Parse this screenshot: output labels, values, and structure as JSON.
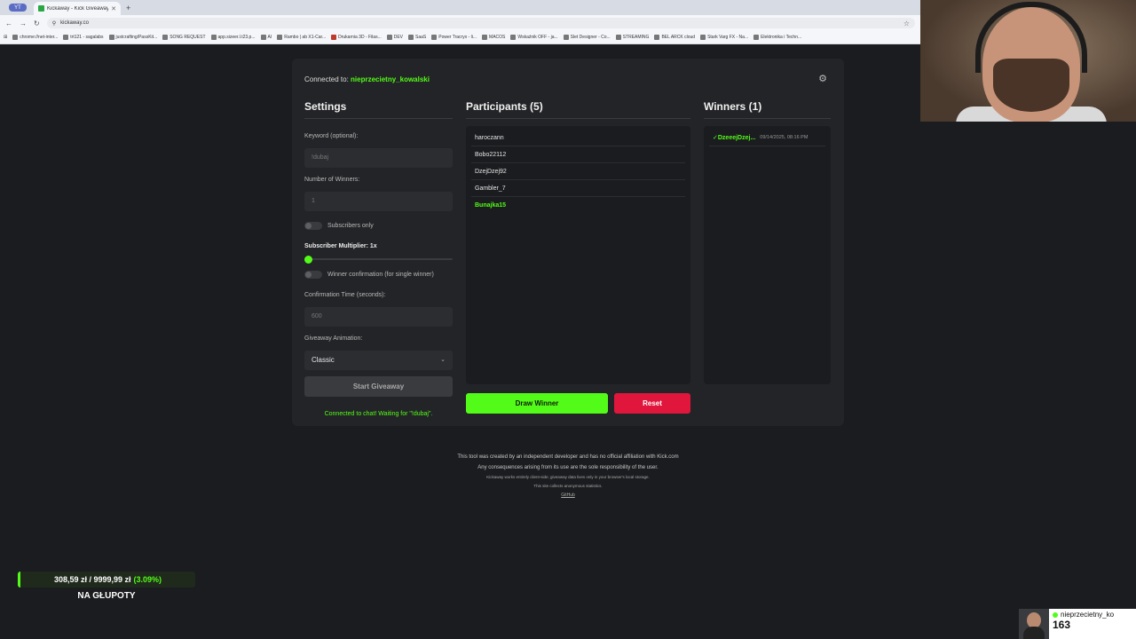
{
  "browser": {
    "tab_group": "YT",
    "tab_title": "Kickaway - Kick Giveaway Tool",
    "url": "kickaway.co",
    "bookmarks": [
      "chrome://net-inter...",
      "trt121 - sagalabs",
      "justcrafting/PassKit...",
      "SONG REQUEST",
      "app.sizeer.l.t23.p...",
      "AI",
      "Rambo | ab X1-Car...",
      "Drukarnia 3D - Filas...",
      "DEV",
      "SaaS",
      "Power Tracryx - li...",
      "MACOS",
      "Wskaźnik OFF - ja...",
      "Slet Designer - Co...",
      "STREAMING",
      "BEL ARCK cloud",
      "Stark Varg FX - Na...",
      "Elektronika i Techn..."
    ]
  },
  "app": {
    "connected_prefix": "Connected to:",
    "connected_user": "nieprzecietny_kowalski",
    "settings": {
      "title": "Settings",
      "keyword_label": "Keyword (optional):",
      "keyword_value": "!dubaj",
      "winners_label": "Number of Winners:",
      "winners_value": "1",
      "subscribers_only_label": "Subscribers only",
      "multiplier_label": "Subscriber Multiplier: 1x",
      "winner_confirmation_label": "Winner confirmation (for single winner)",
      "confirmation_time_label": "Confirmation Time (seconds):",
      "confirmation_time_value": "600",
      "animation_label": "Giveaway Animation:",
      "animation_value": "Classic",
      "start_button": "Start Giveaway",
      "status": "Connected to chat! Waiting for \"!dubaj\"."
    },
    "participants": {
      "title": "Participants (5)",
      "items": [
        {
          "name": "haroczann"
        },
        {
          "name": "Bobo22112"
        },
        {
          "name": "DzejDzej92"
        },
        {
          "name": "Gambler_7"
        },
        {
          "name": "Bunajka15"
        }
      ],
      "draw_button": "Draw Winner",
      "reset_button": "Reset"
    },
    "winners": {
      "title": "Winners (1)",
      "items": [
        {
          "name": "✓DzeeejDzej...",
          "date": "09/14/2025, 08:16 PM"
        }
      ]
    }
  },
  "footer": {
    "line1": "This tool was created by an independent developer and has no official affiliation with Kick.com",
    "line2": "Any consequences arising from its use are the sole responsibility of the user.",
    "line3": "Kickaway works entirely client-side; giveaway data lives only in your browser's local storage.",
    "line4": "This site collects anonymous statistics.",
    "link": "GitHub"
  },
  "overlay": {
    "goal_amount": "308,59 zł / 9999,99 zł",
    "goal_pct": "(3.09%)",
    "goal_label": "NA GŁUPOTY",
    "viewer_name": "nieprzecietny_ko",
    "viewer_count": "163"
  },
  "colors": {
    "accent": "#53fc18",
    "danger": "#e0163c",
    "background": "#1b1c1f",
    "card": "#232427"
  }
}
